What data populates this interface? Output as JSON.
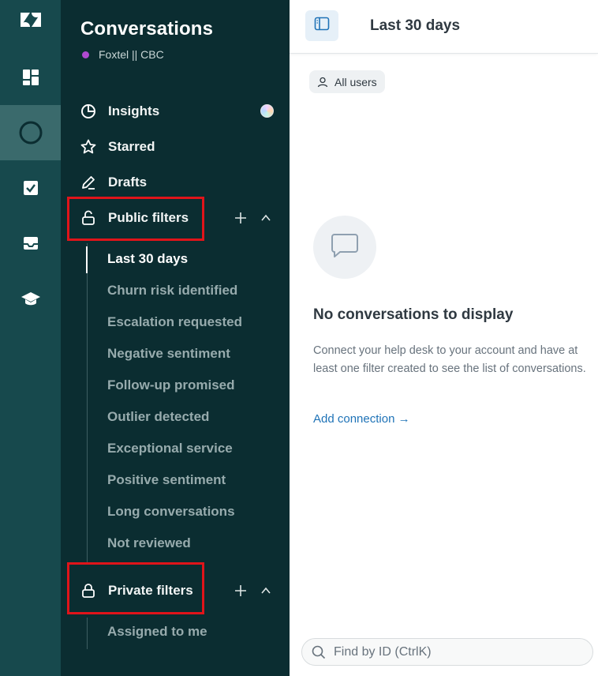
{
  "sidebar": {
    "title": "Conversations",
    "workspace": "Foxtel || CBC",
    "nav": [
      {
        "label": "Insights",
        "icon": "pie-chart-icon"
      },
      {
        "label": "Starred",
        "icon": "star-icon"
      },
      {
        "label": "Drafts",
        "icon": "pencil-icon"
      }
    ],
    "public_filters": {
      "label": "Public filters",
      "items": [
        "Last 30 days",
        "Churn risk identified",
        "Escalation requested",
        "Negative sentiment",
        "Follow-up promised",
        "Outlier detected",
        "Exceptional service",
        "Positive sentiment",
        "Long conversations",
        "Not reviewed"
      ],
      "active": "Last 30 days"
    },
    "private_filters": {
      "label": "Private filters",
      "items": [
        "Assigned to me"
      ]
    }
  },
  "main": {
    "title": "Last 30 days",
    "user_filter": "All users",
    "empty_state": {
      "title": "No conversations to display",
      "description": "Connect your help desk to your account and have at least one filter created to see the list of conversations.",
      "link": "Add connection →"
    },
    "search": {
      "placeholder": "Find by ID (CtrlK)"
    }
  },
  "colors": {
    "rail": "#17494d",
    "sidebar": "#0b2d31",
    "highlight": "#e0141a",
    "link": "#1f73b7"
  }
}
